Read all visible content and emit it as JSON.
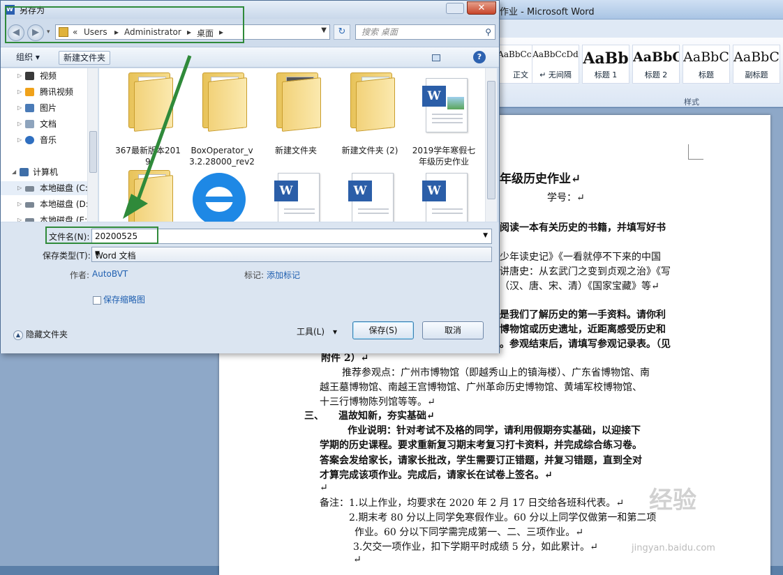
{
  "word": {
    "title": "作业 - Microsoft Word",
    "styles_group_label": "样式",
    "styles": [
      {
        "sample": "AaBbCcDd",
        "name": "正文"
      },
      {
        "sample": "AaBbCcDd",
        "name": "↵ 无间隔"
      },
      {
        "sample": "AaBb",
        "name": "标题 1"
      },
      {
        "sample": "AaBbC",
        "name": "标题 2"
      },
      {
        "sample": "AaBbC",
        "name": "标题"
      },
      {
        "sample": "AaBbC",
        "name": "副标题"
      }
    ],
    "doc_lines": [
      "年级历史作业↵",
      "学号：↵",
      "阅读一本有关历史的书籍，并填写好书",
      "少年读史记》《一看就停不下来的中国",
      "讲唐史：从玄武门之变到贞观之治》《写",
      "（汉、唐、宋、清）《国家宝藏》等↵",
      "是我们了解历史的第一手资料。请你利",
      "博物馆或历史遗址，近距离感受历史和",
      "。参观结束后，请填写参观记录表。（见",
      "附件 2）↵",
      "推荐参观点：广州市博物馆（即越秀山上的镇海楼）、广东省博物馆、南",
      "越王墓博物馆、南越王宫博物馆、广州革命历史博物馆、黄埔军校博物馆、",
      "十三行博物陈列馆等等。↵",
      "三、　　温故知新，夯实基础↵",
      "作业说明：针对考试不及格的同学，请利用假期夯实基础，以迎接下",
      "学期的历史课程。要求重新复习期末考复习打卡资料，并完成综合练习卷。",
      "答案会发给家长，请家长批改，学生需要订正错题，并复习错题，直到全对",
      "才算完成该项作业。完成后，请家长在试卷上签名。↵",
      "↵",
      "备注：1.以上作业，均要求在 2020 年 2 月 17 日交给各班科代表。↵",
      "2.期末考 80 分以上同学免寒假作业。60 分以上同学仅做第一和第二项",
      "作业。60 分以下同学需完成第一、二、三项作业。↵",
      "3.欠交一项作业，扣下学期平时成绩 5 分，如此累计。↵",
      "↵"
    ],
    "watermark": "经验",
    "watermark_url": "jingyan.baidu.com"
  },
  "dialog": {
    "title": "另存为",
    "close_glyph": "✕",
    "address": {
      "crumbs": [
        "«",
        "Users",
        "▸",
        "Administrator",
        "▸",
        "桌面",
        "▸"
      ]
    },
    "search_placeholder": "搜索 桌面",
    "toolbar": {
      "organize": "组织 ▾",
      "new_folder": "新建文件夹",
      "help": "?"
    },
    "nav_items": [
      {
        "label": "视频",
        "icon_color": "#3a3a3a"
      },
      {
        "label": "腾讯视频",
        "icon_color": "#f0a21a"
      },
      {
        "label": "图片",
        "icon_color": "#4a7bb7"
      },
      {
        "label": "文档",
        "icon_color": "#8ea4bd"
      },
      {
        "label": "音乐",
        "icon_color": "#2f6fc0"
      },
      {
        "label": "计算机",
        "icon_color": "#3e6ea8"
      },
      {
        "label": "本地磁盘 (C:",
        "icon_color": "#7b8794"
      },
      {
        "label": "本地磁盘 (D:",
        "icon_color": "#7b8794"
      },
      {
        "label": "本地磁盘 (E:",
        "icon_color": "#7b8794"
      }
    ],
    "files": [
      {
        "label": "367最新版本2019",
        "kind": "folder"
      },
      {
        "label": "BoxOperator_v3.2.28000_rev2",
        "kind": "folder"
      },
      {
        "label": "新建文件夹",
        "kind": "folder"
      },
      {
        "label": "新建文件夹 (2)",
        "kind": "folder"
      },
      {
        "label": "2019学年寒假七年级历史作业",
        "kind": "word"
      }
    ],
    "filename_label": "文件名(N):",
    "filename_value": "20200525",
    "type_label": "保存类型(T):",
    "type_value": "Word 文档",
    "author_label": "作者:",
    "author_value": "AutoBVT",
    "tags_label": "标记:",
    "tags_value": "添加标记",
    "thumbnail_label": "保存缩略图",
    "hide_folders_label": "隐藏文件夹",
    "tools_label": "工具(L)　▾",
    "save_label": "保存(S)",
    "cancel_label": "取消"
  }
}
